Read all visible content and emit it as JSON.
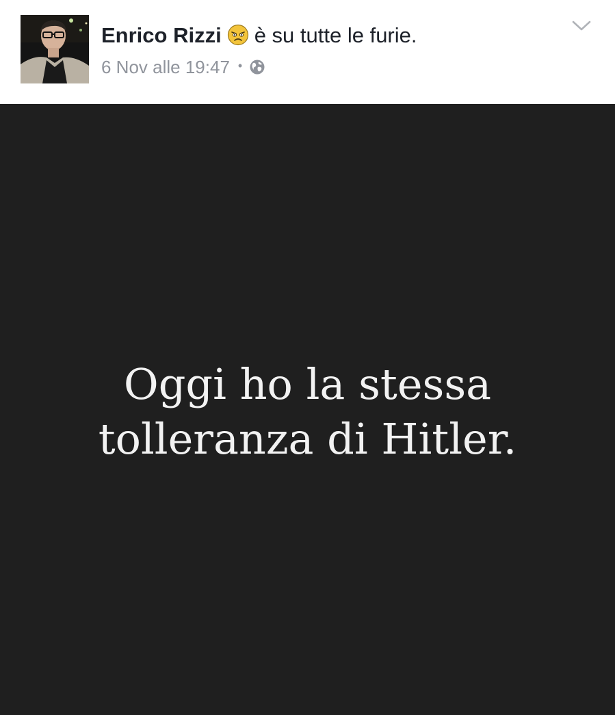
{
  "post": {
    "author_name": "Enrico Rizzi",
    "feeling_icon": "angry-face-emoji",
    "feeling_text": "è su tutte le furie.",
    "timestamp": "6 Nov alle 19:47",
    "separator": "•",
    "privacy_icon": "globe-icon",
    "options_icon": "chevron-down-icon",
    "image_text": {
      "line1": "Oggi ho la stessa",
      "line2": "tolleranza di Hitler."
    }
  },
  "colors": {
    "name_text": "#1d2129",
    "meta_text": "#90949c",
    "image_background": "#1f1f1f",
    "image_text": "#f2f2f2",
    "emoji_fill": "#f3c43b"
  }
}
